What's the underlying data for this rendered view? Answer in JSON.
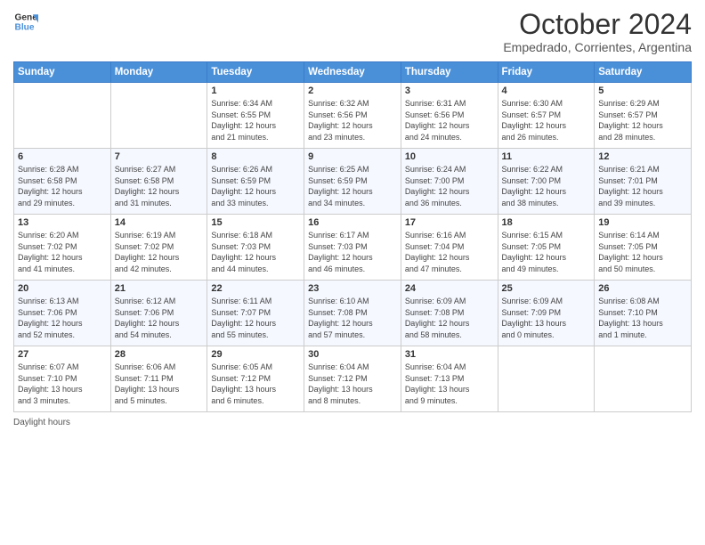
{
  "logo": {
    "line1": "General",
    "line2": "Blue",
    "icon_color": "#4a90d9"
  },
  "title": "October 2024",
  "subtitle": "Empedrado, Corrientes, Argentina",
  "days_of_week": [
    "Sunday",
    "Monday",
    "Tuesday",
    "Wednesday",
    "Thursday",
    "Friday",
    "Saturday"
  ],
  "footer_text": "Daylight hours",
  "weeks": [
    [
      {
        "day": "",
        "info": ""
      },
      {
        "day": "",
        "info": ""
      },
      {
        "day": "1",
        "info": "Sunrise: 6:34 AM\nSunset: 6:55 PM\nDaylight: 12 hours\nand 21 minutes."
      },
      {
        "day": "2",
        "info": "Sunrise: 6:32 AM\nSunset: 6:56 PM\nDaylight: 12 hours\nand 23 minutes."
      },
      {
        "day": "3",
        "info": "Sunrise: 6:31 AM\nSunset: 6:56 PM\nDaylight: 12 hours\nand 24 minutes."
      },
      {
        "day": "4",
        "info": "Sunrise: 6:30 AM\nSunset: 6:57 PM\nDaylight: 12 hours\nand 26 minutes."
      },
      {
        "day": "5",
        "info": "Sunrise: 6:29 AM\nSunset: 6:57 PM\nDaylight: 12 hours\nand 28 minutes."
      }
    ],
    [
      {
        "day": "6",
        "info": "Sunrise: 6:28 AM\nSunset: 6:58 PM\nDaylight: 12 hours\nand 29 minutes."
      },
      {
        "day": "7",
        "info": "Sunrise: 6:27 AM\nSunset: 6:58 PM\nDaylight: 12 hours\nand 31 minutes."
      },
      {
        "day": "8",
        "info": "Sunrise: 6:26 AM\nSunset: 6:59 PM\nDaylight: 12 hours\nand 33 minutes."
      },
      {
        "day": "9",
        "info": "Sunrise: 6:25 AM\nSunset: 6:59 PM\nDaylight: 12 hours\nand 34 minutes."
      },
      {
        "day": "10",
        "info": "Sunrise: 6:24 AM\nSunset: 7:00 PM\nDaylight: 12 hours\nand 36 minutes."
      },
      {
        "day": "11",
        "info": "Sunrise: 6:22 AM\nSunset: 7:00 PM\nDaylight: 12 hours\nand 38 minutes."
      },
      {
        "day": "12",
        "info": "Sunrise: 6:21 AM\nSunset: 7:01 PM\nDaylight: 12 hours\nand 39 minutes."
      }
    ],
    [
      {
        "day": "13",
        "info": "Sunrise: 6:20 AM\nSunset: 7:02 PM\nDaylight: 12 hours\nand 41 minutes."
      },
      {
        "day": "14",
        "info": "Sunrise: 6:19 AM\nSunset: 7:02 PM\nDaylight: 12 hours\nand 42 minutes."
      },
      {
        "day": "15",
        "info": "Sunrise: 6:18 AM\nSunset: 7:03 PM\nDaylight: 12 hours\nand 44 minutes."
      },
      {
        "day": "16",
        "info": "Sunrise: 6:17 AM\nSunset: 7:03 PM\nDaylight: 12 hours\nand 46 minutes."
      },
      {
        "day": "17",
        "info": "Sunrise: 6:16 AM\nSunset: 7:04 PM\nDaylight: 12 hours\nand 47 minutes."
      },
      {
        "day": "18",
        "info": "Sunrise: 6:15 AM\nSunset: 7:05 PM\nDaylight: 12 hours\nand 49 minutes."
      },
      {
        "day": "19",
        "info": "Sunrise: 6:14 AM\nSunset: 7:05 PM\nDaylight: 12 hours\nand 50 minutes."
      }
    ],
    [
      {
        "day": "20",
        "info": "Sunrise: 6:13 AM\nSunset: 7:06 PM\nDaylight: 12 hours\nand 52 minutes."
      },
      {
        "day": "21",
        "info": "Sunrise: 6:12 AM\nSunset: 7:06 PM\nDaylight: 12 hours\nand 54 minutes."
      },
      {
        "day": "22",
        "info": "Sunrise: 6:11 AM\nSunset: 7:07 PM\nDaylight: 12 hours\nand 55 minutes."
      },
      {
        "day": "23",
        "info": "Sunrise: 6:10 AM\nSunset: 7:08 PM\nDaylight: 12 hours\nand 57 minutes."
      },
      {
        "day": "24",
        "info": "Sunrise: 6:09 AM\nSunset: 7:08 PM\nDaylight: 12 hours\nand 58 minutes."
      },
      {
        "day": "25",
        "info": "Sunrise: 6:09 AM\nSunset: 7:09 PM\nDaylight: 13 hours\nand 0 minutes."
      },
      {
        "day": "26",
        "info": "Sunrise: 6:08 AM\nSunset: 7:10 PM\nDaylight: 13 hours\nand 1 minute."
      }
    ],
    [
      {
        "day": "27",
        "info": "Sunrise: 6:07 AM\nSunset: 7:10 PM\nDaylight: 13 hours\nand 3 minutes."
      },
      {
        "day": "28",
        "info": "Sunrise: 6:06 AM\nSunset: 7:11 PM\nDaylight: 13 hours\nand 5 minutes."
      },
      {
        "day": "29",
        "info": "Sunrise: 6:05 AM\nSunset: 7:12 PM\nDaylight: 13 hours\nand 6 minutes."
      },
      {
        "day": "30",
        "info": "Sunrise: 6:04 AM\nSunset: 7:12 PM\nDaylight: 13 hours\nand 8 minutes."
      },
      {
        "day": "31",
        "info": "Sunrise: 6:04 AM\nSunset: 7:13 PM\nDaylight: 13 hours\nand 9 minutes."
      },
      {
        "day": "",
        "info": ""
      },
      {
        "day": "",
        "info": ""
      }
    ]
  ]
}
